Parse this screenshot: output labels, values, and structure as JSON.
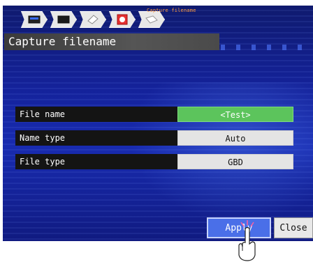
{
  "breadcrumb": {
    "caption": "Capture filename",
    "steps": [
      {
        "icon": "monitor-icon"
      },
      {
        "icon": "screen-icon"
      },
      {
        "icon": "tag-icon"
      },
      {
        "icon": "record-icon"
      },
      {
        "icon": "label-icon"
      }
    ]
  },
  "page": {
    "title": "Capture filename"
  },
  "settings": [
    {
      "label": "File name",
      "value": "<Test>"
    },
    {
      "label": "Name type",
      "value": "Auto"
    },
    {
      "label": "File type",
      "value": "GBD"
    }
  ],
  "buttons": {
    "apply": "Apply",
    "close": "Close"
  },
  "colors": {
    "background": "#14229a",
    "title_bar": "#4a4a4a",
    "selected_value": "#5cc45c",
    "apply_button": "#4a6fe8",
    "breadcrumb_caption": "#ff9a3c"
  }
}
